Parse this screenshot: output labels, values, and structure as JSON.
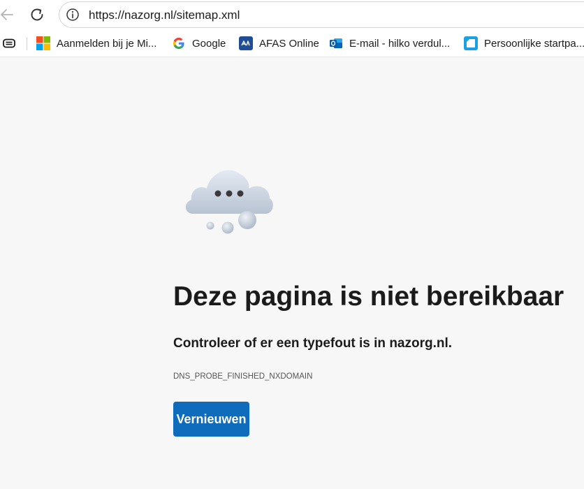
{
  "browser": {
    "url": "https://nazorg.nl/sitemap.xml"
  },
  "bookmarks": [
    {
      "label": "Aanmelden bij je Mi...",
      "icon": "microsoft-icon"
    },
    {
      "label": "Google",
      "icon": "google-icon"
    },
    {
      "label": "AFAS Online",
      "icon": "afas-icon"
    },
    {
      "label": "E-mail - hilko verdul...",
      "icon": "outlook-icon"
    },
    {
      "label": "Persoonlijke startpa...",
      "icon": "start-page-icon"
    }
  ],
  "error": {
    "title": "Deze pagina is niet bereikbaar",
    "subtitle": "Controleer of er een typefout is in nazorg.nl.",
    "code": "DNS_PROBE_FINISHED_NXDOMAIN",
    "reload_label": "Vernieuwen",
    "accent": "#0f6cbd"
  }
}
